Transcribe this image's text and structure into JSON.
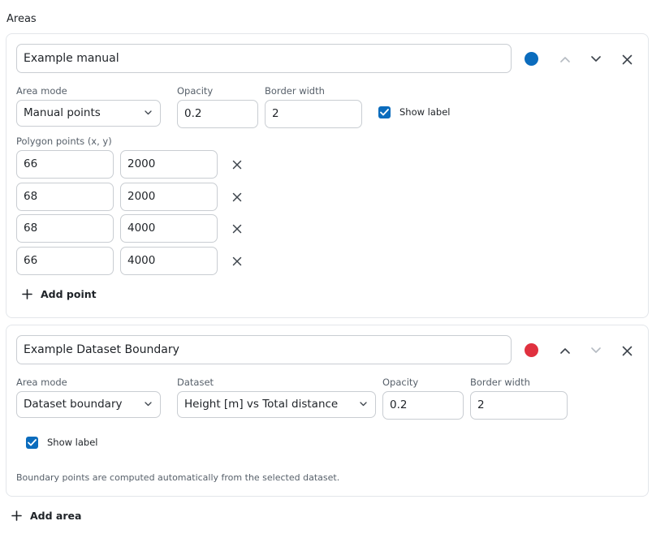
{
  "section": {
    "title": "Areas"
  },
  "colors": {
    "area1_color": "#0b6cbd",
    "area2_color": "#e0313f",
    "checkbox": "#0b6cbd"
  },
  "areas": [
    {
      "name": "Example manual",
      "area_mode_label": "Area mode",
      "area_mode": "Manual points",
      "opacity_label": "Opacity",
      "opacity": "0.2",
      "border_width_label": "Border width",
      "border_width": "2",
      "show_label_text": "Show label",
      "show_label": true,
      "points_label": "Polygon points (x, y)",
      "points": [
        {
          "x": "66",
          "y": "2000"
        },
        {
          "x": "68",
          "y": "2000"
        },
        {
          "x": "68",
          "y": "4000"
        },
        {
          "x": "66",
          "y": "4000"
        }
      ],
      "add_point_label": "Add point"
    },
    {
      "name": "Example Dataset Boundary",
      "area_mode_label": "Area mode",
      "area_mode": "Dataset boundary",
      "dataset_label": "Dataset",
      "dataset": "Height [m] vs Total distance",
      "opacity_label": "Opacity",
      "opacity": "0.2",
      "border_width_label": "Border width",
      "border_width": "2",
      "show_label_text": "Show label",
      "show_label": true,
      "helper_text": "Boundary points are computed automatically from the selected dataset."
    }
  ],
  "add_area_label": "Add area",
  "icons": {
    "up": "chevron-up-icon",
    "down": "chevron-down-icon",
    "close": "close-icon",
    "plus": "plus-icon",
    "check": "check-icon"
  }
}
